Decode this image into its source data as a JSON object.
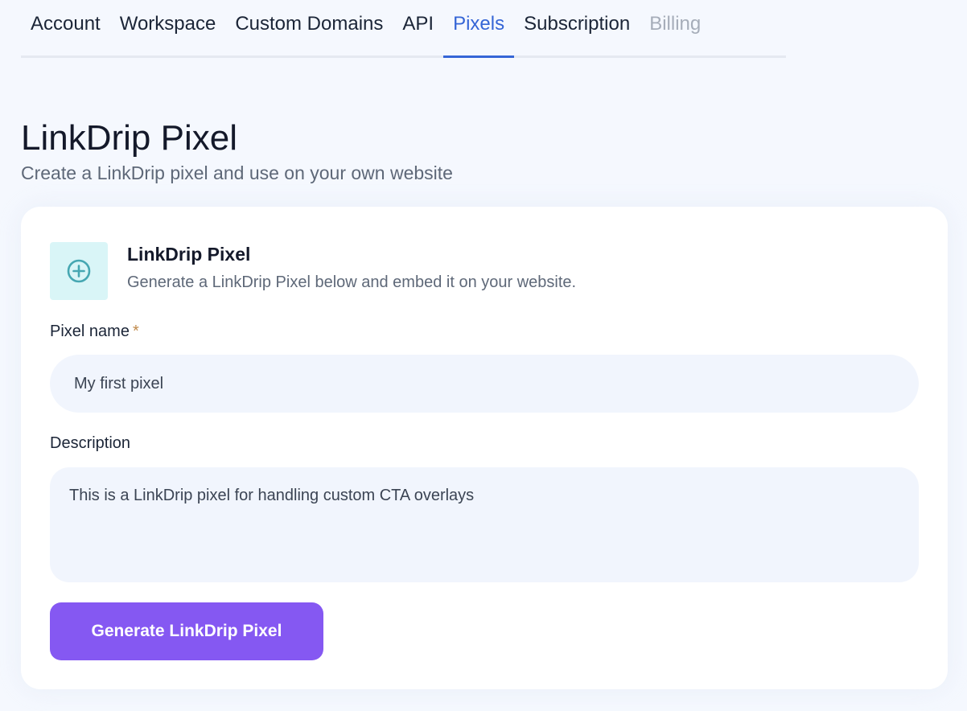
{
  "tabs": [
    {
      "label": "Account",
      "state": "default"
    },
    {
      "label": "Workspace",
      "state": "default"
    },
    {
      "label": "Custom Domains",
      "state": "default"
    },
    {
      "label": "API",
      "state": "default"
    },
    {
      "label": "Pixels",
      "state": "active"
    },
    {
      "label": "Subscription",
      "state": "default"
    },
    {
      "label": "Billing",
      "state": "disabled"
    }
  ],
  "page": {
    "title": "LinkDrip Pixel",
    "subtitle": "Create a LinkDrip pixel and use on your own website"
  },
  "card": {
    "icon": "plus-circle-icon",
    "title": "LinkDrip Pixel",
    "description": "Generate a LinkDrip Pixel below and embed it on your website."
  },
  "form": {
    "pixel_name": {
      "label": "Pixel name",
      "required_mark": "*",
      "value": "My first pixel"
    },
    "description": {
      "label": "Description",
      "value": "This is a LinkDrip pixel for handling custom CTA overlays"
    },
    "submit_label": "Generate LinkDrip Pixel"
  },
  "colors": {
    "active_tab": "#3565d6",
    "primary_button": "#8558f2",
    "icon_bg": "#d9f5f7",
    "icon_fg": "#46a7b2",
    "required_star": "#c08a4b"
  }
}
